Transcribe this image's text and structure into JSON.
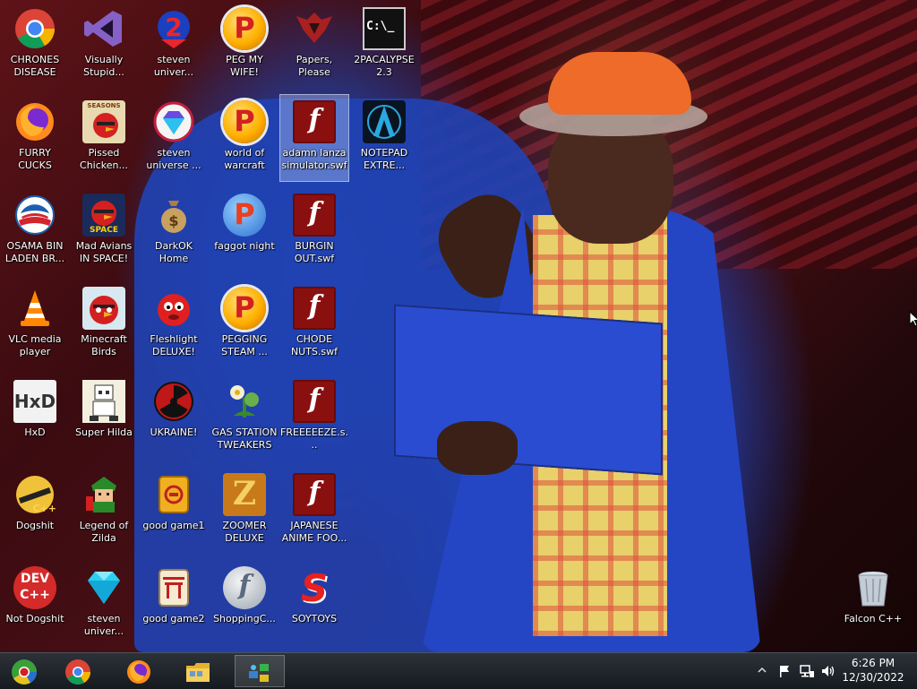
{
  "desktop": {
    "icons": [
      {
        "label": "CHRONES DISEASE"
      },
      {
        "label": "Visually Stupid..."
      },
      {
        "label": "steven univer..."
      },
      {
        "label": "PEG MY WIFE!"
      },
      {
        "label": "Papers, Please"
      },
      {
        "label": "2PACALYPSE 2.3"
      },
      {
        "label": "FURRY CUCKS"
      },
      {
        "label": "Pissed Chicken..."
      },
      {
        "label": "steven universe ..."
      },
      {
        "label": "world of warcraft"
      },
      {
        "label": "adamn lanza simulator.swf"
      },
      {
        "label": "NOTEPAD EXTRE..."
      },
      {
        "label": "OSAMA BIN LADEN BR..."
      },
      {
        "label": "Mad Avians IN SPACE!"
      },
      {
        "label": "DarkOK Home"
      },
      {
        "label": "faggot night"
      },
      {
        "label": "BURGIN OUT.swf"
      },
      {
        "label": "VLC media player"
      },
      {
        "label": "Minecraft Birds"
      },
      {
        "label": "Fleshlight DELUXE!"
      },
      {
        "label": "PEGGING STEAM ..."
      },
      {
        "label": "CHODE NUTS.swf"
      },
      {
        "label": "HxD"
      },
      {
        "label": "Super Hilda"
      },
      {
        "label": "UKRAINE!"
      },
      {
        "label": "GAS STATION TWEAKERS"
      },
      {
        "label": "FREEEEEZE.s..."
      },
      {
        "label": "Dogshit"
      },
      {
        "label": "Legend of Zilda"
      },
      {
        "label": "good game1"
      },
      {
        "label": "ZOOMER DELUXE"
      },
      {
        "label": "JAPANESE ANIME FOO..."
      },
      {
        "label": "Not Dogshit"
      },
      {
        "label": "steven univer..."
      },
      {
        "label": "good game2"
      },
      {
        "label": "ShoppingC..."
      },
      {
        "label": "SOYTOYS"
      },
      {
        "label": "Falcon C++"
      }
    ],
    "icon_text": {
      "cmd": "C:\\_",
      "dev_line1": "DEV",
      "dev_line2": "C++",
      "hxd": "HxD",
      "cpp": "C++",
      "seasons": "SEASONS",
      "space": "SPACE"
    }
  },
  "taskbar": {
    "clock_time": "6:26 PM",
    "clock_date": "12/30/2022"
  },
  "colors": {
    "taskbar_bg": "#1c2228",
    "selection": "#c8dcff",
    "flash_red": "#8a1010"
  }
}
